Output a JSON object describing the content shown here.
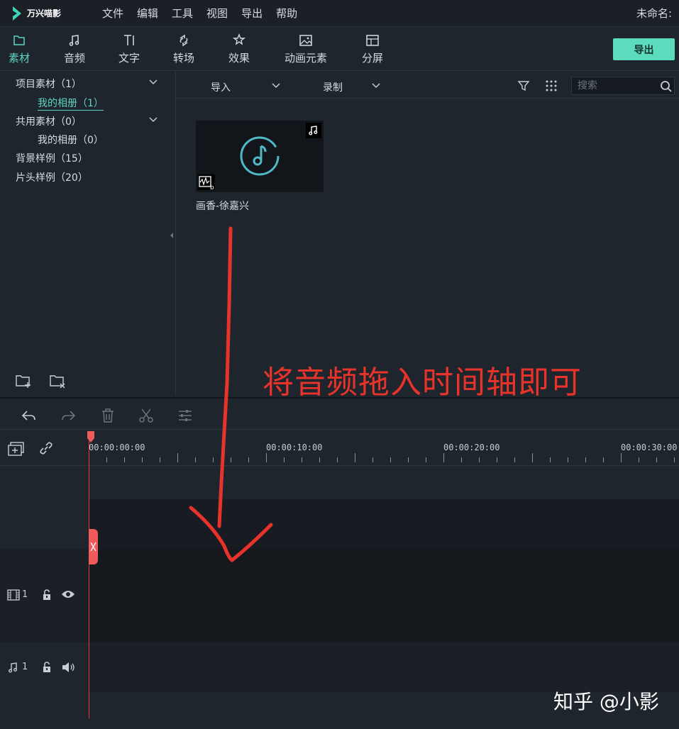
{
  "app": {
    "name": "万兴喵影",
    "doc_title": "未命名:"
  },
  "menu": [
    "文件",
    "编辑",
    "工具",
    "视图",
    "导出",
    "帮助"
  ],
  "tabs": [
    {
      "label": "素材",
      "icon": "folder-icon",
      "active": true
    },
    {
      "label": "音频",
      "icon": "music-note-icon",
      "active": false
    },
    {
      "label": "文字",
      "icon": "text-icon",
      "active": false
    },
    {
      "label": "转场",
      "icon": "transition-icon",
      "active": false
    },
    {
      "label": "效果",
      "icon": "effects-icon",
      "active": false
    },
    {
      "label": "动画元素",
      "icon": "image-icon",
      "active": false
    },
    {
      "label": "分屏",
      "icon": "split-screen-icon",
      "active": false
    }
  ],
  "export_label": "导出",
  "library": {
    "project_media": "项目素材（1）",
    "project_album": "我的相册（1）",
    "shared_media": "共用素材（0）",
    "shared_album": "我的相册（0）",
    "bg_samples": "背景样例（15）",
    "title_samples": "片头样例（20）"
  },
  "media_toolbar": {
    "import": "导入",
    "record": "录制",
    "search_placeholder": "搜索"
  },
  "media_items": [
    {
      "name": "画香-徐嘉兴",
      "type": "audio"
    }
  ],
  "ruler": {
    "labels": [
      "00:00:00:00",
      "00:00:10:00",
      "00:00:20:00",
      "00:00:30:00"
    ]
  },
  "tracks": {
    "video": {
      "number": "1"
    },
    "audio": {
      "number": "1"
    }
  },
  "annotation": {
    "text": "将音频拖入时间轴即可"
  },
  "watermark": "知乎 @小影",
  "colors": {
    "accent": "#5fd4c4",
    "export_button": "#5ddbbd",
    "annotation": "#e8332a",
    "playhead": "#e23b3b"
  }
}
